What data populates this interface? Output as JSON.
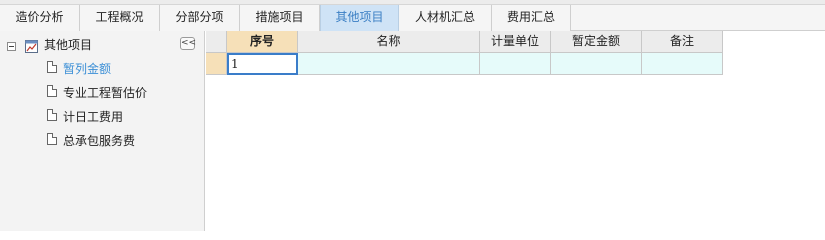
{
  "tabs": [
    {
      "label": "造价分析",
      "active": false
    },
    {
      "label": "工程概况",
      "active": false
    },
    {
      "label": "分部分项",
      "active": false
    },
    {
      "label": "措施项目",
      "active": false
    },
    {
      "label": "其他项目",
      "active": true
    },
    {
      "label": "人材机汇总",
      "active": false
    },
    {
      "label": "费用汇总",
      "active": false
    }
  ],
  "sidebar": {
    "collapse_label": "<<",
    "root": {
      "label": "其他项目",
      "expanded": true
    },
    "items": [
      {
        "label": "暂列金额",
        "selected": true
      },
      {
        "label": "专业工程暂估价",
        "selected": false
      },
      {
        "label": "计日工费用",
        "selected": false
      },
      {
        "label": "总承包服务费",
        "selected": false
      }
    ]
  },
  "table": {
    "columns": [
      "序号",
      "名称",
      "计量单位",
      "暂定金额",
      "备注"
    ],
    "rows": [
      {
        "seq": "1",
        "name": "",
        "unit": "",
        "amount": "",
        "remark": ""
      }
    ]
  },
  "colors": {
    "active_tab_bg": "#cfe3f6",
    "active_tab_text": "#3b7fc4",
    "selected_tree_text": "#3b8fd6",
    "seq_header_bg": "#f6e0b8",
    "data_row_bg": "#e6fbfa",
    "active_cell_border": "#3a7dc9"
  }
}
